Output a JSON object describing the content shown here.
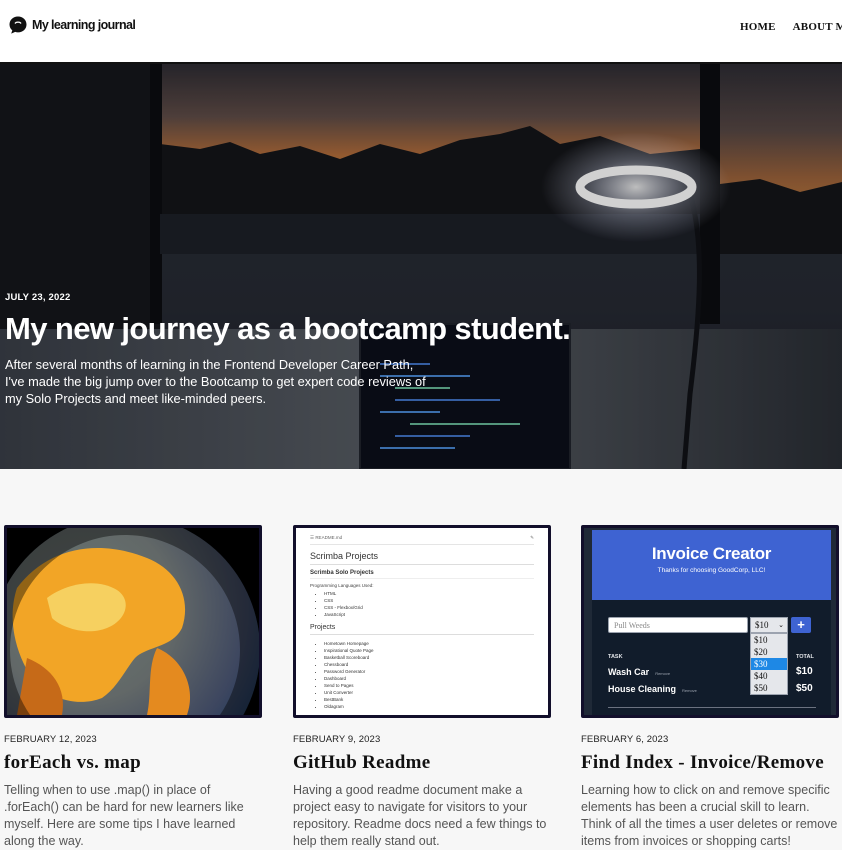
{
  "header": {
    "logo_text": "My learning journal",
    "nav": [
      "HOME",
      "ABOUT ME"
    ]
  },
  "hero": {
    "date": "JULY 23, 2022",
    "title": "My new journey as a bootcamp student.",
    "description": "After several months of learning in the Frontend Developer Career Path, I've made the big jump over to the Bootcamp to get expert code reviews of my Solo Projects and meet like-minded peers."
  },
  "posts": [
    {
      "date": "FEBRUARY 12, 2023",
      "title": "forEach vs. map",
      "excerpt": "Telling when to use .map() in place of .forEach() can be hard for new learners like myself. Here are some tips I have learned along the way."
    },
    {
      "date": "FEBRUARY 9, 2023",
      "title": "GitHub Readme",
      "excerpt": "Having a good readme document make a project easy to navigate for visitors to your repository. Readme docs need a few things to help them really stand out."
    },
    {
      "date": "FEBRUARY 6, 2023",
      "title": "Find Index - Invoice/Remove",
      "excerpt": "Learning how to click on and remove specific elements has been a crucial skill to learn. Think of all the times a user deletes or remove items from invoices or shopping carts!"
    }
  ],
  "readme_thumb": {
    "file": "README.md",
    "title": "Scrimba Projects",
    "subtitle": "Scrimba Solo Projects",
    "languages_label": "Programming Languages Used:",
    "languages": [
      "HTML",
      "CSS",
      "CSS - Flexbox/Grid",
      "JavaScript"
    ],
    "projects_heading": "Projects",
    "projects": [
      "Hometown Homepage",
      "Inspirational Quote Page",
      "Basketball Scoreboard",
      "Chessboard",
      "Password Generator",
      "Dashboard",
      "Send to Pages",
      "Unit Converter",
      "BestBank",
      "Oldagram"
    ]
  },
  "invoice_thumb": {
    "title": "Invoice Creator",
    "subtitle": "Thanks for choosing GoodCorp, LLC!",
    "input_placeholder": "Pull Weeds",
    "select_value": "$10",
    "add_label": "+",
    "options": [
      "$10",
      "$20",
      "$30",
      "$40",
      "$50"
    ],
    "selected_option": "$30",
    "task_header": "TASK",
    "total_header": "TOTAL",
    "rows": [
      {
        "task": "Wash Car",
        "remove": "Remove",
        "amount": "$10"
      },
      {
        "task": "House Cleaning",
        "remove": "Remove",
        "amount": "$50"
      }
    ]
  }
}
